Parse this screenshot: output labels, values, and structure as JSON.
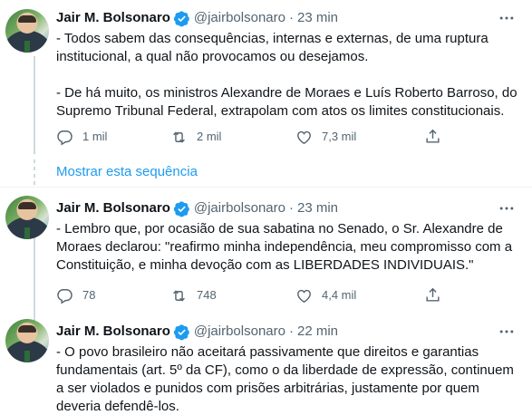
{
  "tweets": [
    {
      "name": "Jair M. Bolsonaro",
      "handle": "@jairbolsonaro",
      "dot": "·",
      "time": "23 min",
      "text": "- Todos sabem das consequências, internas e externas, de uma ruptura\ninstitucional, a qual não provocamos ou desejamos.\n\n- De há muito, os ministros Alexandre de Moraes e Luís Roberto Barroso, do\nSupremo Tribunal Federal, extrapolam com atos os limites constitucionais.",
      "replies": "1 mil",
      "retweets": "2 mil",
      "likes": "7,3 mil"
    },
    {
      "name": "Jair M. Bolsonaro",
      "handle": "@jairbolsonaro",
      "dot": "·",
      "time": "23 min",
      "text": "- Lembro que, por ocasião de sua sabatina no Senado, o Sr. Alexandre de\nMoraes declarou: \"reafirmo minha independência, meu compromisso com a\nConstituição, e minha devoção com as LIBERDADES INDIVIDUAIS.\"",
      "replies": "78",
      "retweets": "748",
      "likes": "4,4 mil"
    },
    {
      "name": "Jair M. Bolsonaro",
      "handle": "@jairbolsonaro",
      "dot": "·",
      "time": "22 min",
      "text": "- O povo brasileiro não aceitará passivamente que direitos e garantias\nfundamentais (art. 5º da CF), como o da liberdade de expressão, continuem\na ser violados e punidos com prisões arbitrárias, justamente por quem\ndeveria defendê-los.",
      "replies": "",
      "retweets": "",
      "likes": ""
    }
  ],
  "show_thread_label": "Mostrar esta sequência",
  "colors": {
    "link": "#1d9bf0",
    "muted": "#536471",
    "verified": "#1d9bf0"
  },
  "icons": [
    "verified-badge-icon",
    "more-icon",
    "reply-icon",
    "retweet-icon",
    "like-icon",
    "share-icon"
  ]
}
